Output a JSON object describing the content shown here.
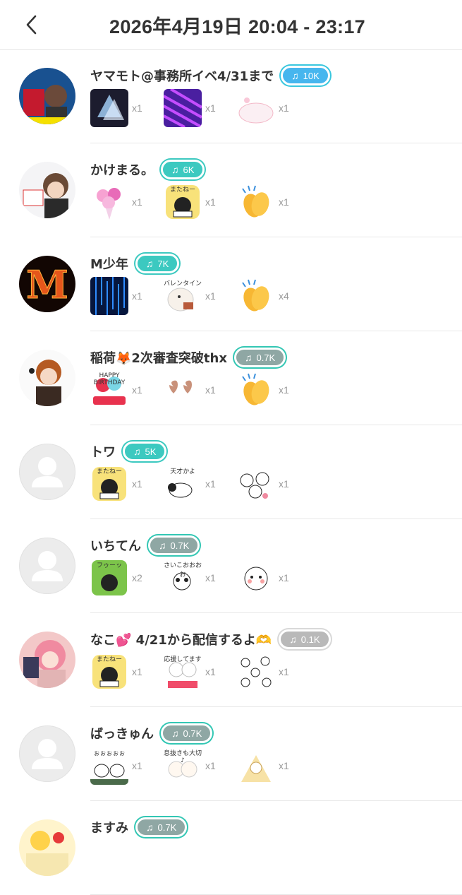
{
  "header": {
    "title": "2026年4月19日 20:04 - 23:17"
  },
  "rows": [
    {
      "name": "ヤマモト@事務所イベ4/31まで",
      "badge": "10K",
      "badge_style": "blue",
      "gifts": [
        {
          "icon": "crystal-horse-icon",
          "count": "x1"
        },
        {
          "icon": "purple-pattern-icon",
          "count": "x1"
        },
        {
          "icon": "white-cat-icon",
          "count": "x1"
        }
      ]
    },
    {
      "name": "かけまる。",
      "badge": "6K",
      "badge_style": "teal",
      "gifts": [
        {
          "icon": "flower-bouquet-icon",
          "count": "x1"
        },
        {
          "icon": "matane-sticker-icon",
          "count": "x1",
          "caption": "またねー"
        },
        {
          "icon": "clapping-hands-icon",
          "count": "x1"
        }
      ]
    },
    {
      "name": "M少年",
      "badge": "7K",
      "badge_style": "teal",
      "gifts": [
        {
          "icon": "blue-light-rain-icon",
          "count": "x1"
        },
        {
          "icon": "valentine-bird-icon",
          "count": "x1",
          "caption": "バレンタイン"
        },
        {
          "icon": "clapping-hands-icon",
          "count": "x4"
        }
      ]
    },
    {
      "name": "稲荷🦊2次審査突破thx",
      "badge": "0.7K",
      "badge_style": "tealdark",
      "gifts": [
        {
          "icon": "happy-birthday-balloon-icon",
          "count": "x1",
          "caption": "HAPPY BIRTHDAY"
        },
        {
          "icon": "brown-hearts-icon",
          "count": "x1"
        },
        {
          "icon": "clapping-hands-icon",
          "count": "x1"
        }
      ]
    },
    {
      "name": "トワ",
      "badge": "5K",
      "badge_style": "teal",
      "gifts": [
        {
          "icon": "matane-sticker-icon",
          "count": "x1",
          "caption": "またねー"
        },
        {
          "icon": "panda-tensai-icon",
          "count": "x1",
          "caption": "天才かよ"
        },
        {
          "icon": "panda-group-icon",
          "count": "x1"
        }
      ]
    },
    {
      "name": "いちてん",
      "badge": "0.7K",
      "badge_style": "tealdark",
      "gifts": [
        {
          "icon": "black-cat-fuu-icon",
          "count": "x2",
          "caption": "フゥーッ"
        },
        {
          "icon": "panda-saikou-icon",
          "count": "x1",
          "caption": "さいこおおおお"
        },
        {
          "icon": "white-bear-icon",
          "count": "x1"
        }
      ]
    },
    {
      "name": "なこ💕 4/21から配信するよ🫶",
      "badge": "0.1K",
      "badge_style": "gray",
      "gifts": [
        {
          "icon": "matane-sticker-icon",
          "count": "x1",
          "caption": "またねー"
        },
        {
          "icon": "cheer-bears-icon",
          "count": "x1",
          "caption": "応援してます"
        },
        {
          "icon": "many-pandas-icon",
          "count": "x1"
        }
      ]
    },
    {
      "name": "ばっきゅん",
      "badge": "0.7K",
      "badge_style": "tealdark",
      "gifts": [
        {
          "icon": "cats-ooo-icon",
          "count": "x1",
          "caption": "ぉぉぉぉぉ"
        },
        {
          "icon": "bears-breather-icon",
          "count": "x1",
          "caption": "息抜きも大切♪"
        },
        {
          "icon": "yellow-dog-icon",
          "count": "x1"
        }
      ]
    },
    {
      "name": "ますみ",
      "badge": "0.7K",
      "badge_style": "tealdark",
      "gifts": []
    }
  ]
}
